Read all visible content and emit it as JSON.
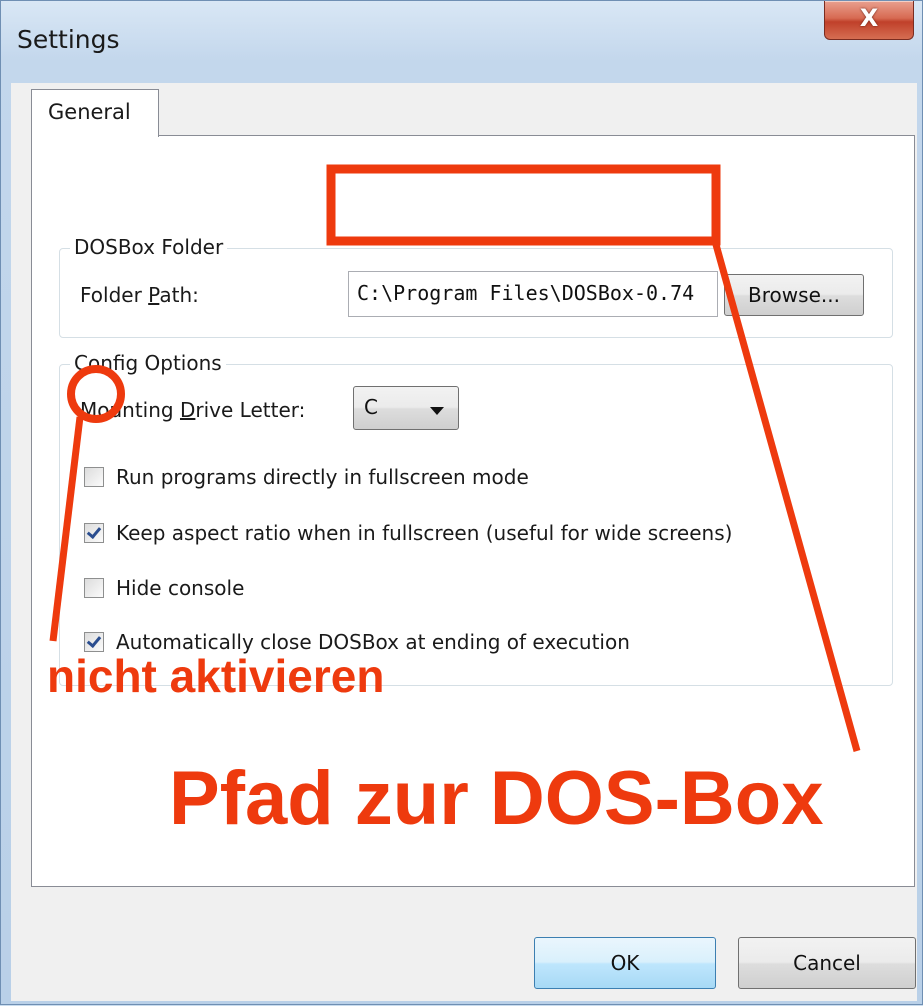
{
  "window": {
    "title": "Settings",
    "close_glyph": "X"
  },
  "tabs": [
    {
      "label": "General",
      "selected": true
    }
  ],
  "dosbox_folder": {
    "legend": "DOSBox Folder",
    "path_label_pre": "Folder ",
    "path_label_accel": "P",
    "path_label_post": "ath:",
    "path_value": "C:\\Program Files\\DOSBox-0.74",
    "browse_label": "Browse..."
  },
  "config_options": {
    "legend": "Config Options",
    "drive_label_pre": "Mounting ",
    "drive_label_accel": "D",
    "drive_label_post": "rive Letter:",
    "drive_value": "C",
    "checkboxes": [
      {
        "label": "Run programs directly in fullscreen mode",
        "checked": false
      },
      {
        "label": "Keep aspect ratio when in fullscreen (useful for wide screens)",
        "checked": true
      },
      {
        "label": "Hide console",
        "checked": false
      },
      {
        "label": "Automatically close DOSBox at ending of execution",
        "checked": true
      }
    ]
  },
  "footer": {
    "ok_label": "OK",
    "cancel_label": "Cancel"
  },
  "annotations": {
    "color": "#ee3a0e",
    "note_fullscreen": "nicht aktivieren",
    "note_path": "Pfad zur DOS-Box"
  }
}
